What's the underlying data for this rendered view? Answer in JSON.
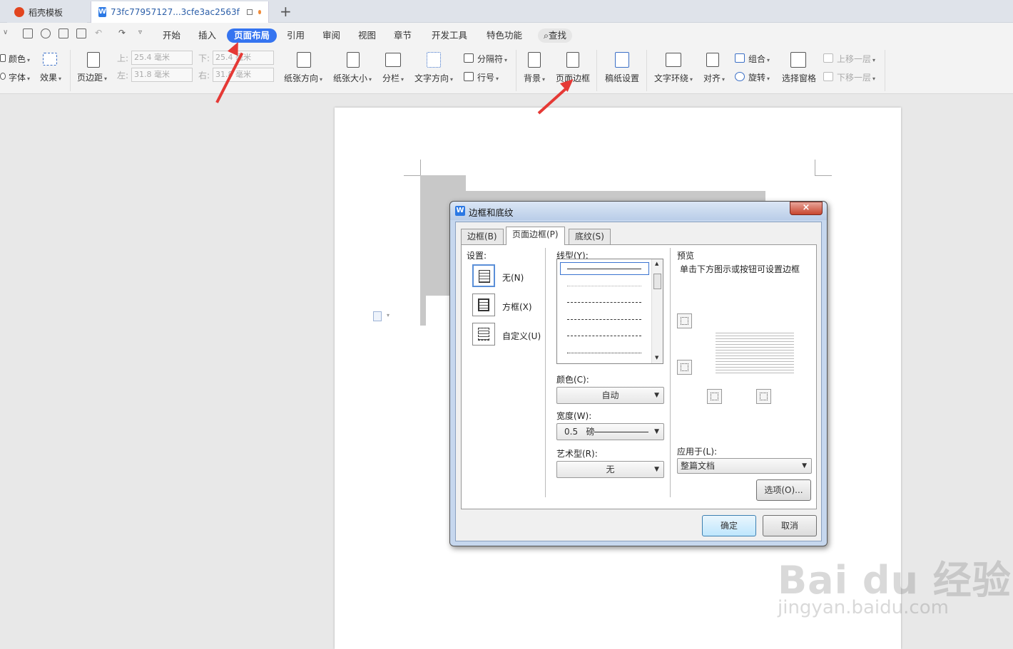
{
  "tabs": [
    {
      "label": "稻壳模板"
    },
    {
      "label": "73fc77957127...3cfe3ac2563f"
    }
  ],
  "menu": [
    "开始",
    "插入",
    "页面布局",
    "引用",
    "审阅",
    "视图",
    "章节",
    "开发工具",
    "特色功能",
    "查找"
  ],
  "ribbon": {
    "color": "颜色",
    "font": "字体",
    "effect": "效果",
    "margin": "页边距",
    "top_lbl": "上:",
    "top_val": "25.4 毫米",
    "bottom_lbl": "下:",
    "bottom_val": "25.4 毫米",
    "left_lbl": "左:",
    "left_val": "31.8 毫米",
    "right_lbl": "右:",
    "right_val": "31.8 毫米",
    "orientation": "纸张方向",
    "size": "纸张大小",
    "columns": "分栏",
    "text_dir": "文字方向",
    "separator": "分隔符",
    "line_num": "行号",
    "background": "背景",
    "page_border": "页面边框",
    "paper_set": "稿纸设置",
    "wrap": "文字环绕",
    "align": "对齐",
    "group": "组合",
    "rotate": "旋转",
    "sel_pane": "选择窗格",
    "bring_fwd": "上移一层",
    "send_back": "下移一层"
  },
  "dialog": {
    "title": "边框和底纹",
    "tabs": [
      "边框(B)",
      "页面边框(P)",
      "底纹(S)"
    ],
    "setting_label": "设置:",
    "settings": [
      "无(N)",
      "方框(X)",
      "自定义(U)"
    ],
    "line_style_label": "线型(Y):",
    "color_label": "颜色(C):",
    "color_val": "自动",
    "width_label": "宽度(W):",
    "width_val": "0.5",
    "width_unit": "磅",
    "art_label": "艺术型(R):",
    "art_val": "无",
    "preview_label": "预览",
    "preview_hint": "单击下方图示或按钮可设置边框",
    "apply_label": "应用于(L):",
    "apply_val": "整篇文档",
    "options_btn": "选项(O)...",
    "ok_btn": "确定",
    "cancel_btn": "取消"
  },
  "watermark": {
    "logo": "Bai du 经验",
    "url": "jingyan.baidu.com"
  }
}
